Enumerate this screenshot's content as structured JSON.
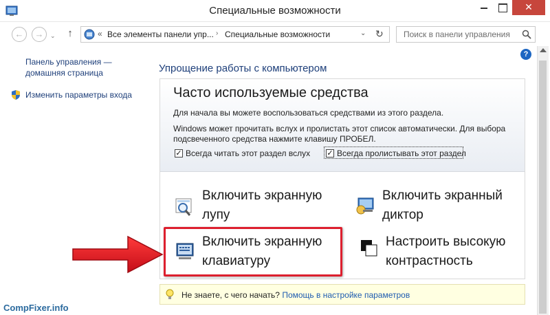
{
  "window": {
    "title": "Специальные возможности",
    "close_glyph": "✕"
  },
  "nav": {
    "back_glyph": "←",
    "forward_glyph": "→",
    "up_glyph": "↑",
    "address": {
      "prefix": "«",
      "crumb1": "Все элементы панели упр...",
      "arrow": "›",
      "crumb2": "Специальные возможности",
      "dropdown_glyph": "⌄",
      "refresh_glyph": "↻"
    },
    "search_placeholder": "Поиск в панели управления"
  },
  "sidebar": {
    "home_line1": "Панель управления —",
    "home_line2": "домашняя страница",
    "login_label": "Изменить параметры входа"
  },
  "help_glyph": "?",
  "main": {
    "header": "Упрощение работы с компьютером",
    "frequent": {
      "title": "Часто используемые средства",
      "desc1": "Для начала вы можете воспользоваться средствами из этого раздела.",
      "desc2": "Windows может прочитать вслух и пролистать этот список автоматически. Для выбора подсвеченного средства нажмите клавишу ПРОБЕЛ.",
      "checkbox_read": "Всегда читать этот раздел вслух",
      "checkbox_scan": "Всегда пролистывать этот раздел",
      "check_glyph": "✓"
    },
    "tools": {
      "magnifier": {
        "line1": "Включить экранную",
        "line2": "лупу"
      },
      "narrator": {
        "line1": "Включить экранный",
        "line2": "диктор"
      },
      "keyboard": {
        "line1": "Включить экранную",
        "line2": "клавиатуру"
      },
      "contrast": {
        "line1": "Настроить высокую",
        "line2": "контрастность"
      }
    },
    "tip": {
      "text": "Не знаете, с чего начать?",
      "link": "Помощь в настройке параметров"
    }
  },
  "footer": {
    "watermark": "CompFixer.info"
  },
  "colors": {
    "link": "#1e3f7a",
    "close_button": "#c7463c",
    "highlight": "#dd1f2e",
    "tip_background": "#ffffe1"
  }
}
